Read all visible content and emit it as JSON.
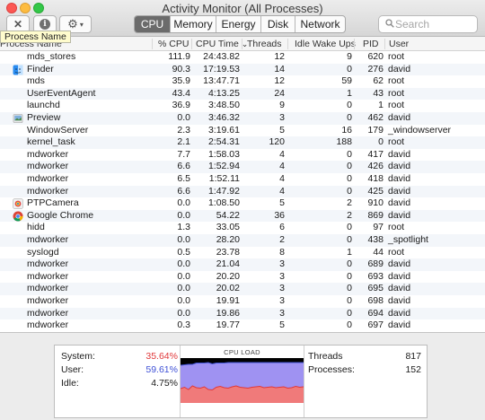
{
  "window": {
    "title": "Activity Monitor (All Processes)"
  },
  "toolbar": {
    "tabs": [
      "CPU",
      "Memory",
      "Energy",
      "Disk",
      "Network"
    ],
    "active_tab": "CPU",
    "search_placeholder": "Search"
  },
  "tooltip": "Process Name",
  "columns": {
    "name": "Process Name",
    "cpu": "% CPU",
    "cpu_time": "CPU Time",
    "threads": "Threads",
    "idle_wake_ups": "Idle Wake Ups",
    "pid": "PID",
    "user": "User",
    "sort_indicator": "⌄"
  },
  "rows": [
    {
      "name": "mds_stores",
      "icon": "none",
      "cpu": "111.9",
      "time": "24:43.82",
      "threads": "12",
      "idle": "9",
      "pid": "620",
      "user": "root"
    },
    {
      "name": "Finder",
      "icon": "finder-icon",
      "cpu": "90.3",
      "time": "17:19.53",
      "threads": "14",
      "idle": "0",
      "pid": "276",
      "user": "david"
    },
    {
      "name": "mds",
      "icon": "none",
      "cpu": "35.9",
      "time": "13:47.71",
      "threads": "12",
      "idle": "59",
      "pid": "62",
      "user": "root"
    },
    {
      "name": "UserEventAgent",
      "icon": "none",
      "cpu": "43.4",
      "time": "4:13.25",
      "threads": "24",
      "idle": "1",
      "pid": "43",
      "user": "root"
    },
    {
      "name": "launchd",
      "icon": "none",
      "cpu": "36.9",
      "time": "3:48.50",
      "threads": "9",
      "idle": "0",
      "pid": "1",
      "user": "root"
    },
    {
      "name": "Preview",
      "icon": "preview-icon",
      "cpu": "0.0",
      "time": "3:46.32",
      "threads": "3",
      "idle": "0",
      "pid": "462",
      "user": "david"
    },
    {
      "name": "WindowServer",
      "icon": "none",
      "cpu": "2.3",
      "time": "3:19.61",
      "threads": "5",
      "idle": "16",
      "pid": "179",
      "user": "_windowserver"
    },
    {
      "name": "kernel_task",
      "icon": "none",
      "cpu": "2.1",
      "time": "2:54.31",
      "threads": "120",
      "idle": "188",
      "pid": "0",
      "user": "root"
    },
    {
      "name": "mdworker",
      "icon": "none",
      "cpu": "7.7",
      "time": "1:58.03",
      "threads": "4",
      "idle": "0",
      "pid": "417",
      "user": "david"
    },
    {
      "name": "mdworker",
      "icon": "none",
      "cpu": "6.6",
      "time": "1:52.94",
      "threads": "4",
      "idle": "0",
      "pid": "426",
      "user": "david"
    },
    {
      "name": "mdworker",
      "icon": "none",
      "cpu": "6.5",
      "time": "1:52.11",
      "threads": "4",
      "idle": "0",
      "pid": "418",
      "user": "david"
    },
    {
      "name": "mdworker",
      "icon": "none",
      "cpu": "6.6",
      "time": "1:47.92",
      "threads": "4",
      "idle": "0",
      "pid": "425",
      "user": "david"
    },
    {
      "name": "PTPCamera",
      "icon": "ptpcamera-icon",
      "cpu": "0.0",
      "time": "1:08.50",
      "threads": "5",
      "idle": "2",
      "pid": "910",
      "user": "david"
    },
    {
      "name": "Google Chrome",
      "icon": "chrome-icon",
      "cpu": "0.0",
      "time": "54.22",
      "threads": "36",
      "idle": "2",
      "pid": "869",
      "user": "david"
    },
    {
      "name": "hidd",
      "icon": "none",
      "cpu": "1.3",
      "time": "33.05",
      "threads": "6",
      "idle": "0",
      "pid": "97",
      "user": "root"
    },
    {
      "name": "mdworker",
      "icon": "none",
      "cpu": "0.0",
      "time": "28.20",
      "threads": "2",
      "idle": "0",
      "pid": "438",
      "user": "_spotlight"
    },
    {
      "name": "syslogd",
      "icon": "none",
      "cpu": "0.5",
      "time": "23.78",
      "threads": "8",
      "idle": "1",
      "pid": "44",
      "user": "root"
    },
    {
      "name": "mdworker",
      "icon": "none",
      "cpu": "0.0",
      "time": "21.04",
      "threads": "3",
      "idle": "0",
      "pid": "689",
      "user": "david"
    },
    {
      "name": "mdworker",
      "icon": "none",
      "cpu": "0.0",
      "time": "20.20",
      "threads": "3",
      "idle": "0",
      "pid": "693",
      "user": "david"
    },
    {
      "name": "mdworker",
      "icon": "none",
      "cpu": "0.0",
      "time": "20.02",
      "threads": "3",
      "idle": "0",
      "pid": "695",
      "user": "david"
    },
    {
      "name": "mdworker",
      "icon": "none",
      "cpu": "0.0",
      "time": "19.91",
      "threads": "3",
      "idle": "0",
      "pid": "698",
      "user": "david"
    },
    {
      "name": "mdworker",
      "icon": "none",
      "cpu": "0.0",
      "time": "19.86",
      "threads": "3",
      "idle": "0",
      "pid": "694",
      "user": "david"
    },
    {
      "name": "mdworker",
      "icon": "none",
      "cpu": "0.3",
      "time": "19.77",
      "threads": "5",
      "idle": "0",
      "pid": "697",
      "user": "david"
    }
  ],
  "summary": {
    "system_label": "System:",
    "system_value": "35.64%",
    "user_label": "User:",
    "user_value": "59.61%",
    "idle_label": "Idle:",
    "idle_value": "4.75%",
    "cpu_load_title": "CPU LOAD",
    "threads_label": "Threads",
    "threads_value": "817",
    "processes_label": "Processes:",
    "processes_value": "152"
  },
  "colors": {
    "system": "#e0383a",
    "user": "#3f51d6",
    "system_fill": "#f07a7a",
    "user_fill": "#9f92f2",
    "row_alt": "#f3f6fa",
    "active_tab": "#6b6b6b"
  },
  "cpu_load_history": {
    "system_percent": [
      32,
      35,
      30,
      38,
      34,
      33,
      36,
      30,
      29,
      35,
      37,
      34,
      33,
      36,
      38,
      35,
      34,
      33,
      35,
      36,
      37,
      34,
      35,
      36,
      34,
      35,
      36,
      33,
      34,
      37,
      35,
      36
    ],
    "user_percent": [
      52,
      50,
      56,
      48,
      55,
      56,
      53,
      60,
      58,
      54,
      52,
      55,
      57,
      54,
      52,
      55,
      56,
      57,
      55,
      54,
      53,
      56,
      55,
      54,
      56,
      55,
      54,
      57,
      56,
      53,
      55,
      54
    ]
  }
}
